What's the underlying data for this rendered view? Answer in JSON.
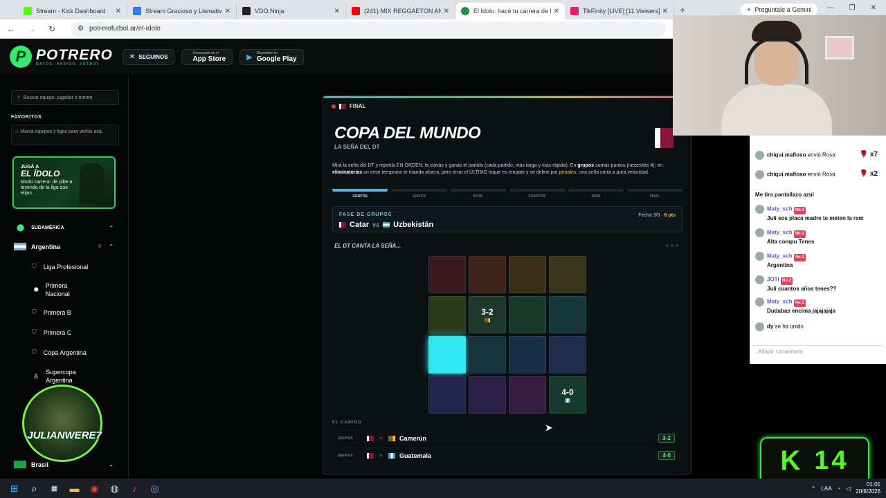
{
  "browser": {
    "tabs": [
      {
        "title": "Stream - Kick Dashboard",
        "color": "#53fc18"
      },
      {
        "title": "Stream Gracioso y Llamativo Id",
        "color": "#2b7de9"
      },
      {
        "title": "VDO.Ninja",
        "color": "#222222"
      },
      {
        "title": "(241) MIX REGGAETON AN",
        "color": "#ff0000"
      },
      {
        "title": "El Ídolo: hacé tu carrera de fútb",
        "color": "#1f8f3f"
      },
      {
        "title": "TikFinity [LIVE] [11 Viewers]",
        "color": "#e91e63"
      }
    ],
    "gemini_label": "Pregúntale a Gemini",
    "url": "potrerofutbol.ar/el-idolo"
  },
  "site": {
    "logo_letter": "P",
    "logo_name": "POTRERO",
    "logo_tag": "DATOS. PASIÓN. FÚTBOL.",
    "follow_label": "SEGUINOS",
    "appstore_small": "Conseguilo en el",
    "appstore_big": "App Store",
    "google_small": "Disponible en",
    "google_big": "Google Play"
  },
  "sidebar": {
    "search_placeholder": "Buscar equipo, jugador o torneo",
    "favorites_title": "FAVORITOS",
    "favorites_hint": "Marcá equipos y ligas para verlos acá.",
    "promo_pre": "JUGÁ A",
    "promo_title": "EL ÍDOLO",
    "promo_desc": "Modo carrera: de pibe a leyenda de la liga que elijas",
    "region": "SUDAMÉRICA",
    "country": "Argentina",
    "country_count": "8",
    "leagues": [
      "Liga Profesional",
      "Primera Nacional",
      "Primera B",
      "Primera C",
      "Copa Argentina",
      "Supercopa Argentina"
    ],
    "country2": "Brasil",
    "overlay_name": "JULIANWERE7"
  },
  "card": {
    "badge": "FINAL",
    "title": "COPA DEL MUNDO",
    "subtitle": "LA SEÑA DEL DT",
    "desc_a": "Mirá la seña del DT y repetila EN ORDEN: la clavás y ganás el partido (cada partido, más larga y más rápida). En ",
    "desc_b": "grupos",
    "desc_c": " sumás puntos (necesitás 4); en ",
    "desc_d": "eliminatorias",
    "desc_e": " un error temprano te manda afuera, pero errar el ÚLTIMO toque es empate y se define por ",
    "desc_f": "penales",
    "desc_g": ": una seña corta a pura velocidad.",
    "steps": [
      "GRUPOS",
      "16AVOS",
      "8VOS",
      "CUARTOS",
      "SEMI",
      "FINAL"
    ],
    "phase_label": "FASE DE GRUPOS",
    "home": "Catar",
    "vs": "vs",
    "away": "Uzbekistán",
    "fecha": "Fecha 3/3 · ",
    "pts": "6 pts",
    "dt_label": "EL DT CANTA LA SEÑA...",
    "grid_colors": [
      "#3a1b24",
      "#3c2419",
      "#3a2f17",
      "#37361a",
      "#2c3a1a",
      "#1d3a2b",
      "#173a2d",
      "#17383a",
      "#2ee6ee",
      "#16333c",
      "#172d44",
      "#1e2c4a",
      "#22234a",
      "#2a2046",
      "#361c40",
      "#163a2e"
    ],
    "grid_scores": {
      "5": "3-2",
      "15": "4-0"
    },
    "camino_label": "EL CAMINO",
    "road": [
      {
        "group": "GRUPOS",
        "vs": "vs",
        "team": "Camerún",
        "score": "3-2"
      },
      {
        "group": "GRUPOS",
        "vs": "vs",
        "team": "Guatemala",
        "score": "4-0"
      }
    ]
  },
  "chat": {
    "messages": [
      {
        "user": "chiqui.mafioso",
        "text": "envió Rosa",
        "extra": "x7"
      },
      {
        "user": "chiqui.mafioso",
        "text": "envió Rosa",
        "extra": "x2"
      },
      {
        "user": "",
        "text": "Me tira pantallazo azul",
        "extra": ""
      },
      {
        "user": "Maty_sch",
        "text": "Juli sos placa madre te meten la ram",
        "extra": "No.1"
      },
      {
        "user": "Maty_sch",
        "text": "Alta compu Tenes",
        "extra": "No.1"
      },
      {
        "user": "Maty_sch",
        "text": "Argentina",
        "extra": "No.1"
      },
      {
        "user": "JOTI",
        "text": "Juli cuantos años tenes??",
        "extra": "No.2"
      },
      {
        "user": "Maty_sch",
        "text": "Dudabas encima jajajajaja",
        "extra": "No.1"
      },
      {
        "user": "dy",
        "text": "se ha unido",
        "extra": ""
      }
    ],
    "input_placeholder": "Añadir comentario"
  },
  "kick": {
    "letter": "K",
    "count": "14"
  },
  "taskbar": {
    "lang": "LAA",
    "time": "01:01",
    "date": "20/8/2026"
  }
}
